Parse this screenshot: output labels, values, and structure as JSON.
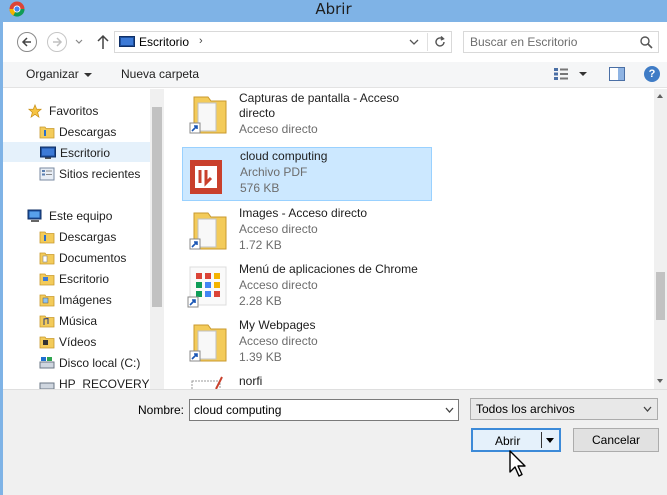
{
  "window": {
    "title": "Abrir"
  },
  "address": {
    "path": "Escritorio",
    "separator": "›"
  },
  "search": {
    "placeholder": "Buscar en Escritorio"
  },
  "toolbar": {
    "organize_label": "Organizar",
    "new_folder_label": "Nueva carpeta",
    "help_label": "?"
  },
  "sidebar": {
    "items": [
      {
        "label": "Favoritos",
        "icon": "star-icon"
      },
      {
        "label": "Descargas",
        "icon": "folder-download-icon"
      },
      {
        "label": "Escritorio",
        "icon": "desktop-icon",
        "selected": true
      },
      {
        "label": "Sitios recientes",
        "icon": "recent-places-icon"
      },
      {
        "label": "Este equipo",
        "icon": "computer-icon"
      },
      {
        "label": "Descargas",
        "icon": "folder-download-icon"
      },
      {
        "label": "Documentos",
        "icon": "folder-documents-icon"
      },
      {
        "label": "Escritorio",
        "icon": "folder-desktop-icon"
      },
      {
        "label": "Imágenes",
        "icon": "folder-pictures-icon"
      },
      {
        "label": "Música",
        "icon": "folder-music-icon"
      },
      {
        "label": "Vídeos",
        "icon": "folder-videos-icon"
      },
      {
        "label": "Disco local (C:)",
        "icon": "drive-icon"
      },
      {
        "label": "HP_RECOVERY (D",
        "icon": "drive-icon"
      }
    ]
  },
  "files": [
    {
      "name": "Capturas de pantalla - Acceso directo",
      "type": "Acceso directo",
      "size": "",
      "icon": "folder-shortcut-icon"
    },
    {
      "name": "cloud computing",
      "type": "Archivo PDF",
      "size": "576 KB",
      "icon": "pdf-file-icon",
      "selected": true
    },
    {
      "name": "Images - Acceso directo",
      "type": "Acceso directo",
      "size": "1.72 KB",
      "icon": "folder-shortcut-icon"
    },
    {
      "name": "Menú de aplicaciones de Chrome",
      "type": "Acceso directo",
      "size": "2.28 KB",
      "icon": "chrome-apps-shortcut-icon"
    },
    {
      "name": "My Webpages",
      "type": "Acceso directo",
      "size": "1.39 KB",
      "icon": "folder-shortcut-icon"
    },
    {
      "name": "norfi",
      "type": "",
      "size": "",
      "icon": "text-file-icon"
    }
  ],
  "footer": {
    "name_label": "Nombre:",
    "name_value": "cloud computing",
    "filter_value": "Todos los archivos",
    "open_label": "Abrir",
    "cancel_label": "Cancelar"
  },
  "colors": {
    "titlebar": "#7fb3e6",
    "selection": "#cce8ff",
    "accent": "#3c8ad8"
  }
}
